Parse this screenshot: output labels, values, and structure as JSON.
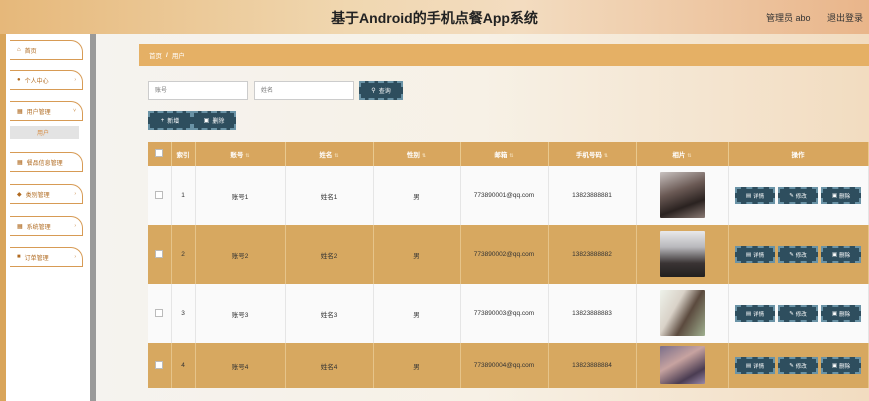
{
  "header": {
    "title": "基于Android的手机点餐App系统",
    "user": "管理员 abo",
    "logout": "退出登录"
  },
  "sidebar": {
    "items": [
      {
        "label": "首页",
        "icon": "home-icon",
        "glyph": "⌂"
      },
      {
        "label": "个人中心",
        "icon": "user-icon",
        "glyph": "●"
      },
      {
        "label": "用户管理",
        "icon": "grid-icon",
        "glyph": "▦"
      },
      {
        "label": "餐品信息管理",
        "icon": "grid-icon",
        "glyph": "▦"
      },
      {
        "label": "类别管理",
        "icon": "pin-icon",
        "glyph": "◆"
      },
      {
        "label": "系统管理",
        "icon": "grid-icon",
        "glyph": "▦"
      },
      {
        "label": "订单管理",
        "icon": "cart-icon",
        "glyph": "■"
      }
    ],
    "submenu": "用户"
  },
  "breadcrumb": {
    "home": "首页",
    "sep": "/",
    "current": "用户"
  },
  "search": {
    "account_placeholder": "账号",
    "name_placeholder": "姓名",
    "query_label": "查询",
    "query_icon": "search-icon"
  },
  "toolbar": {
    "add_label": "新增",
    "delete_label": "删除"
  },
  "table": {
    "headers": [
      "索引",
      "账号",
      "姓名",
      "性别",
      "邮箱",
      "手机号码",
      "相片",
      "操作"
    ],
    "rows": [
      {
        "index": "1",
        "account": "账号1",
        "name": "姓名1",
        "gender": "男",
        "email": "773890001@qq.com",
        "phone": "13823888881"
      },
      {
        "index": "2",
        "account": "账号2",
        "name": "姓名2",
        "gender": "男",
        "email": "773890002@qq.com",
        "phone": "13823888882"
      },
      {
        "index": "3",
        "account": "账号3",
        "name": "姓名3",
        "gender": "男",
        "email": "773890003@qq.com",
        "phone": "13823888883"
      },
      {
        "index": "4",
        "account": "账号4",
        "name": "姓名4",
        "gender": "男",
        "email": "773890004@qq.com",
        "phone": "13823888884"
      }
    ],
    "actions": {
      "detail": "详情",
      "edit": "修改",
      "delete": "删除"
    }
  },
  "colors": {
    "accent": "#d8a65e",
    "button": "#2e4e5e",
    "sidebar_border": "#d79b55"
  }
}
